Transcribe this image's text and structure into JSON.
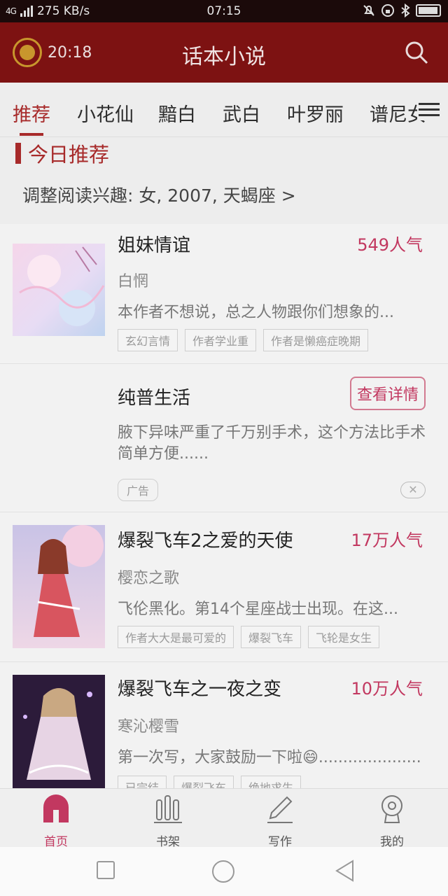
{
  "status_bar": {
    "network": "4G",
    "speed": "275 KB/s",
    "time": "07:15"
  },
  "app_bar": {
    "timer": "20:18",
    "title": "话本小说"
  },
  "tabs": [
    {
      "label": "推荐"
    },
    {
      "label": "小花仙"
    },
    {
      "label": "黯白"
    },
    {
      "label": "武白"
    },
    {
      "label": "叶罗丽"
    },
    {
      "label": "谱尼女"
    }
  ],
  "section": {
    "title": "今日推荐",
    "interest": "调整阅读兴趣: 女, 2007, 天蝎座 >"
  },
  "books": [
    {
      "title": "姐妹情谊",
      "popularity": "549人气",
      "author": "白惘",
      "desc": "本作者不想说，总之人物跟你们想象的...",
      "tags": [
        "玄幻言情",
        "作者学业重",
        "作者是懒癌症晚期"
      ]
    },
    {
      "title": "爆裂飞车2之爱的天使",
      "popularity": "17万人气",
      "author": "樱恋之歌",
      "desc": "飞伦黑化。第14个星座战士出现。在这...",
      "tags": [
        "作者大大是最可爱的",
        "爆裂飞车",
        "飞轮是女生"
      ]
    },
    {
      "title": "爆裂飞车之一夜之变",
      "popularity": "10万人气",
      "author": "寒沁樱雪",
      "desc": "第一次写，大家鼓励一下啦😄.....................",
      "tags": [
        "已完结",
        "爆裂飞车",
        "绝地求生"
      ]
    }
  ],
  "ad": {
    "title": "纯普生活",
    "button": "查看详情",
    "desc": "腋下异味严重了千万别手术，这个方法比手术简单方便......",
    "tag": "广告",
    "close": "✕"
  },
  "bottom_nav": [
    {
      "label": "首页",
      "icon": "home-icon"
    },
    {
      "label": "书架",
      "icon": "bookshelf-icon"
    },
    {
      "label": "写作",
      "icon": "pen-icon"
    },
    {
      "label": "我的",
      "icon": "profile-icon"
    }
  ],
  "colors": {
    "appbar": "#7d1212",
    "accent": "#a72a2a",
    "popularity": "#c23860"
  }
}
